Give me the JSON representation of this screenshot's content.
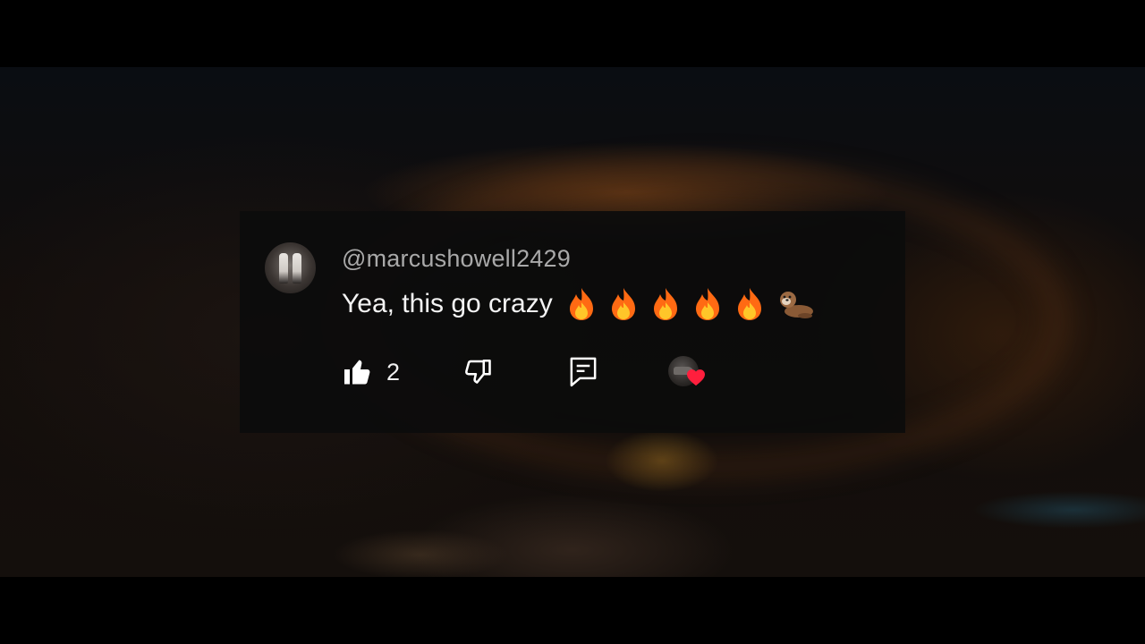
{
  "comment": {
    "username": "@marcushowell2429",
    "text": "Yea, this go crazy",
    "emojis": [
      "fire",
      "fire",
      "fire",
      "fire",
      "fire",
      "otter"
    ],
    "like_count": "2",
    "creator_heart": true,
    "heart_color": "#ff1f3d"
  },
  "colors": {
    "card_background": "#0c0c0c",
    "username": "#a9a9a9",
    "text": "#f4f4f4",
    "icons": "#ffffff"
  },
  "icons": {
    "like": "thumbs-up-icon",
    "dislike": "thumbs-down-icon",
    "reply": "reply-comment-icon",
    "heart": "heart-icon"
  }
}
